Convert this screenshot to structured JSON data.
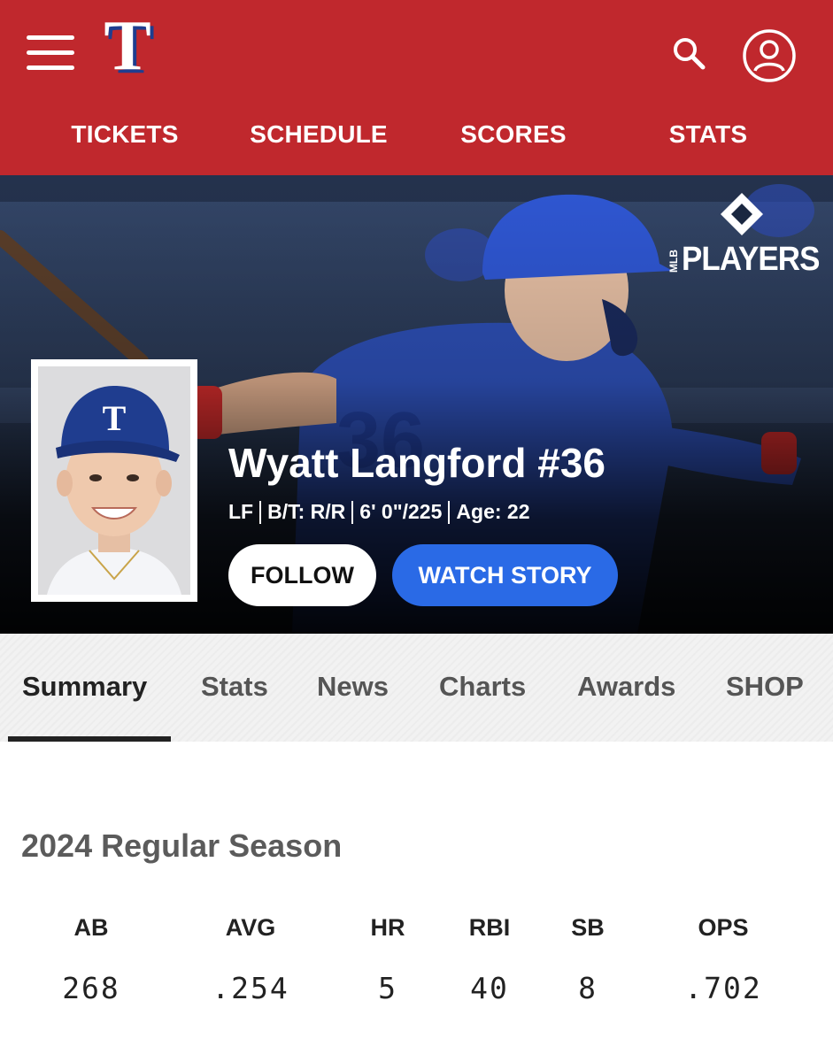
{
  "header": {
    "logo_letter": "T",
    "nav": [
      "TICKETS",
      "SCHEDULE",
      "SCORES",
      "STATS"
    ]
  },
  "hero": {
    "brand_logo_text": "PLAYERS",
    "brand_logo_sub": "MLB",
    "player_name": "Wyatt Langford #36",
    "position": "LF",
    "bats_throws": "B/T: R/R",
    "height_weight": "6' 0\"/225",
    "age": "Age: 22",
    "follow_label": "FOLLOW",
    "watch_label": "WATCH STORY"
  },
  "tabs": [
    "Summary",
    "Stats",
    "News",
    "Charts",
    "Awards",
    "SHOP"
  ],
  "active_tab": "Summary",
  "summary": {
    "title": "2024 Regular Season",
    "stats": [
      {
        "label": "AB",
        "value": "268"
      },
      {
        "label": "AVG",
        "value": ".254"
      },
      {
        "label": "HR",
        "value": "5"
      },
      {
        "label": "RBI",
        "value": "40"
      },
      {
        "label": "SB",
        "value": "8"
      },
      {
        "label": "OPS",
        "value": ".702"
      }
    ]
  },
  "colors": {
    "header_red": "#c0282d",
    "watch_blue": "#2a6ae6",
    "rangers_blue": "#1f3d8f"
  },
  "icons": [
    "menu-icon",
    "team-logo-icon",
    "search-icon",
    "account-icon",
    "mlb-players-logo-icon"
  ]
}
